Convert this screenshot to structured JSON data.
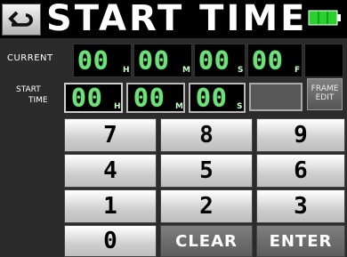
{
  "header": {
    "title": "START TIME",
    "back_icon": "return-arrow-icon",
    "battery_icon": "battery-icon",
    "battery_level": 1.0,
    "colors": {
      "battery": "#29d12f",
      "title_bg": "#000000"
    }
  },
  "current": {
    "label": "CURRENT",
    "hours": "00",
    "minutes": "00",
    "seconds": "00",
    "frames": "00",
    "units": {
      "h": "H",
      "m": "M",
      "s": "S",
      "f": "F"
    }
  },
  "start_time": {
    "label_line1": "START",
    "label_line2": "TIME",
    "hours": "00",
    "minutes": "00",
    "seconds": "00",
    "units": {
      "h": "H",
      "m": "M",
      "s": "S"
    },
    "frame_edit_line1": "FRAME",
    "frame_edit_line2": "EDIT"
  },
  "keypad": {
    "keys": [
      "7",
      "8",
      "9",
      "4",
      "5",
      "6",
      "1",
      "2",
      "3",
      "0"
    ],
    "clear": "CLEAR",
    "enter": "ENTER"
  },
  "colors": {
    "segment_green": "#6ee27a",
    "panel_bg": "#2b2b2b"
  }
}
